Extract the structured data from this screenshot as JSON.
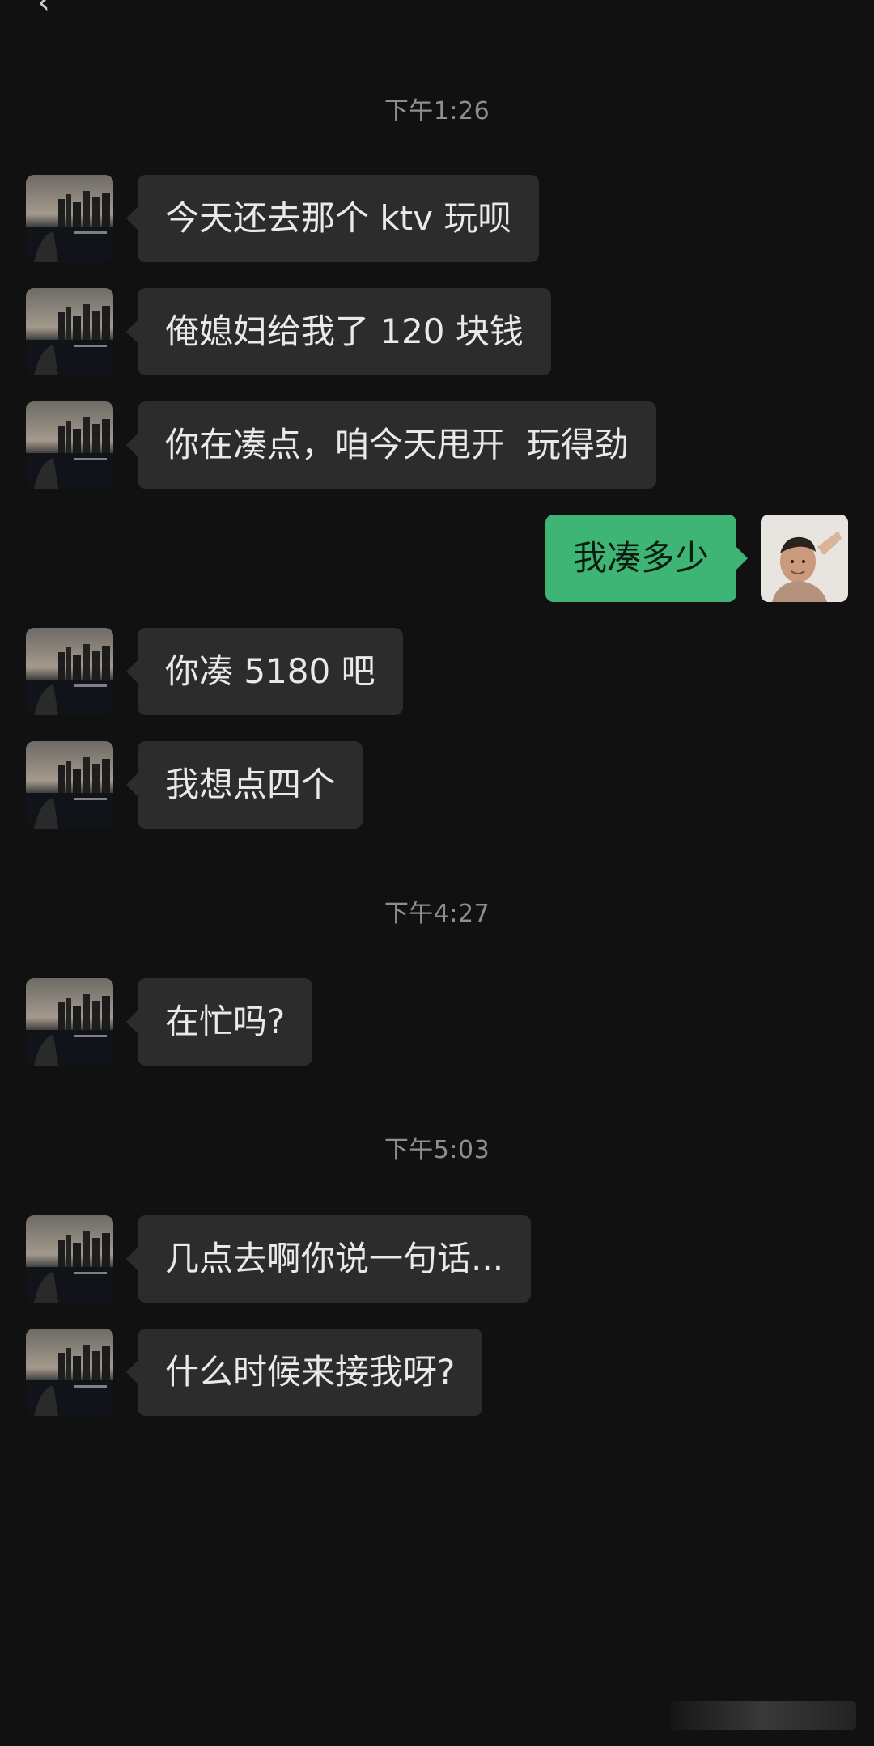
{
  "colors": {
    "background": "#111111",
    "incoming_bubble": "#2c2c2c",
    "outgoing_bubble": "#3eb575",
    "timestamp_text": "#8e8e8e"
  },
  "timestamps": [
    "下午1:26",
    "下午4:27",
    "下午5:03"
  ],
  "messages": [
    {
      "side": "in",
      "text": "今天还去那个 ktv 玩呗",
      "avatar": "city-night-avatar"
    },
    {
      "side": "in",
      "text": "俺媳妇给我了 120 块钱",
      "avatar": "city-night-avatar"
    },
    {
      "side": "in",
      "text": "你在凑点，咱今天甩开  玩得劲",
      "avatar": "city-night-avatar"
    },
    {
      "side": "out",
      "text": "我凑多少",
      "avatar": "user-photo-avatar"
    },
    {
      "side": "in",
      "text": "你凑 5180 吧",
      "avatar": "city-night-avatar"
    },
    {
      "side": "in",
      "text": "我想点四个",
      "avatar": "city-night-avatar"
    },
    {
      "side": "in",
      "text": "在忙吗?",
      "avatar": "city-night-avatar"
    },
    {
      "side": "in",
      "text": "几点去啊你说一句话...",
      "avatar": "city-night-avatar"
    },
    {
      "side": "in",
      "text": "什么时候来接我呀?",
      "avatar": "city-night-avatar"
    }
  ]
}
